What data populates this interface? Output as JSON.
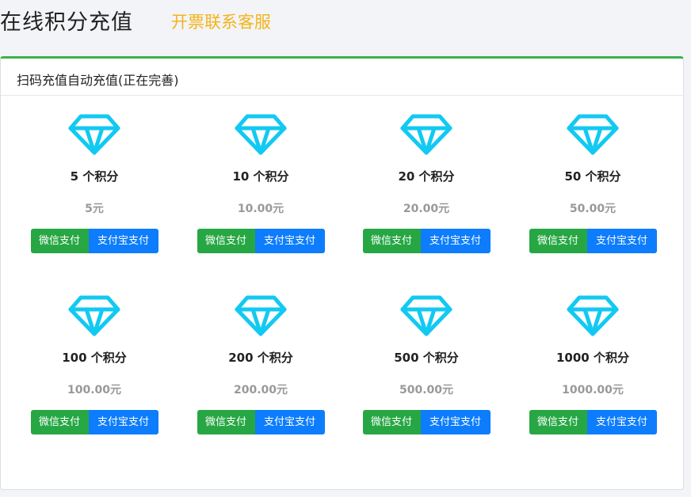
{
  "header": {
    "title": "在线积分充值",
    "invoice_link": "开票联系客服"
  },
  "card": {
    "title": "扫码充值自动充值(正在完善)"
  },
  "colors": {
    "gem": "#12c9f2",
    "wechat": "#27a744",
    "alipay": "#0d7dfd",
    "card_top_border": "#3eaf4f",
    "invoice_link": "#f3b41b"
  },
  "packages": [
    {
      "points": "5 个积分",
      "price": "5元",
      "wechat_label": "微信支付",
      "alipay_label": "支付宝支付"
    },
    {
      "points": "10 个积分",
      "price": "10.00元",
      "wechat_label": "微信支付",
      "alipay_label": "支付宝支付"
    },
    {
      "points": "20 个积分",
      "price": "20.00元",
      "wechat_label": "微信支付",
      "alipay_label": "支付宝支付"
    },
    {
      "points": "50 个积分",
      "price": "50.00元",
      "wechat_label": "微信支付",
      "alipay_label": "支付宝支付"
    },
    {
      "points": "100 个积分",
      "price": "100.00元",
      "wechat_label": "微信支付",
      "alipay_label": "支付宝支付"
    },
    {
      "points": "200 个积分",
      "price": "200.00元",
      "wechat_label": "微信支付",
      "alipay_label": "支付宝支付"
    },
    {
      "points": "500 个积分",
      "price": "500.00元",
      "wechat_label": "微信支付",
      "alipay_label": "支付宝支付"
    },
    {
      "points": "1000 个积分",
      "price": "1000.00元",
      "wechat_label": "微信支付",
      "alipay_label": "支付宝支付"
    }
  ]
}
